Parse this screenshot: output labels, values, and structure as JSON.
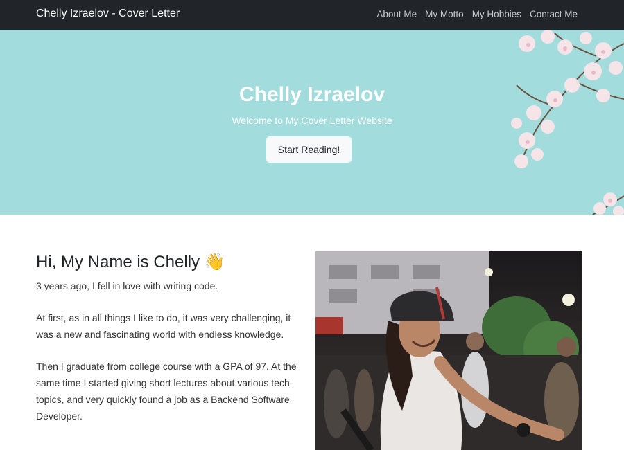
{
  "navbar": {
    "brand": "Chelly Izraelov - Cover Letter",
    "links": [
      "About Me",
      "My Motto",
      "My Hobbies",
      "Contact Me"
    ]
  },
  "hero": {
    "title": "Chelly Izraelov",
    "subtitle": "Welcome to My Cover Letter Website",
    "button_label": "Start Reading!"
  },
  "about": {
    "heading": "Hi, My Name is Chelly 👋",
    "paragraphs": [
      "3 years ago, I fell in love with writing code.",
      "At first, as in all things I like to do, it was very challenging, it was a new and fascinating world with endless knowledge.",
      "Then I graduate from college course with a GPA of 97. At the same time I started giving short lectures about various tech-topics, and very quickly found a job as a Backend Software Developer."
    ]
  },
  "colors": {
    "navbar_bg": "#212529",
    "hero_bg": "#a2dcdc",
    "button_bg": "#f8f9fa"
  },
  "icons": {
    "greeting": "waving-hand-icon",
    "decoration": "cherry-blossom-branch"
  }
}
